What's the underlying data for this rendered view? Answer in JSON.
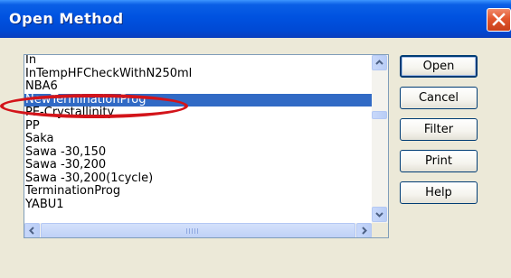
{
  "window": {
    "title": "Open Method",
    "close_icon": "close-icon"
  },
  "list": {
    "items": [
      "In",
      "InTempHFCheckWithN250ml",
      "NBA6",
      "NewTerminationProg",
      "PE-Crystallinity",
      "PP",
      "Saka",
      "Sawa -30,150",
      "Sawa -30,200",
      "Sawa -30,200(1cycle)",
      "TerminationProg",
      "YABU1"
    ],
    "selected": "NewTerminationProg"
  },
  "buttons": {
    "open": "Open",
    "cancel": "Cancel",
    "filter": "Filter",
    "print": "Print",
    "help": "Help"
  },
  "colors": {
    "selection": "#316ac5",
    "annotation": "#d3141a",
    "titlebar": "#0052e0"
  }
}
